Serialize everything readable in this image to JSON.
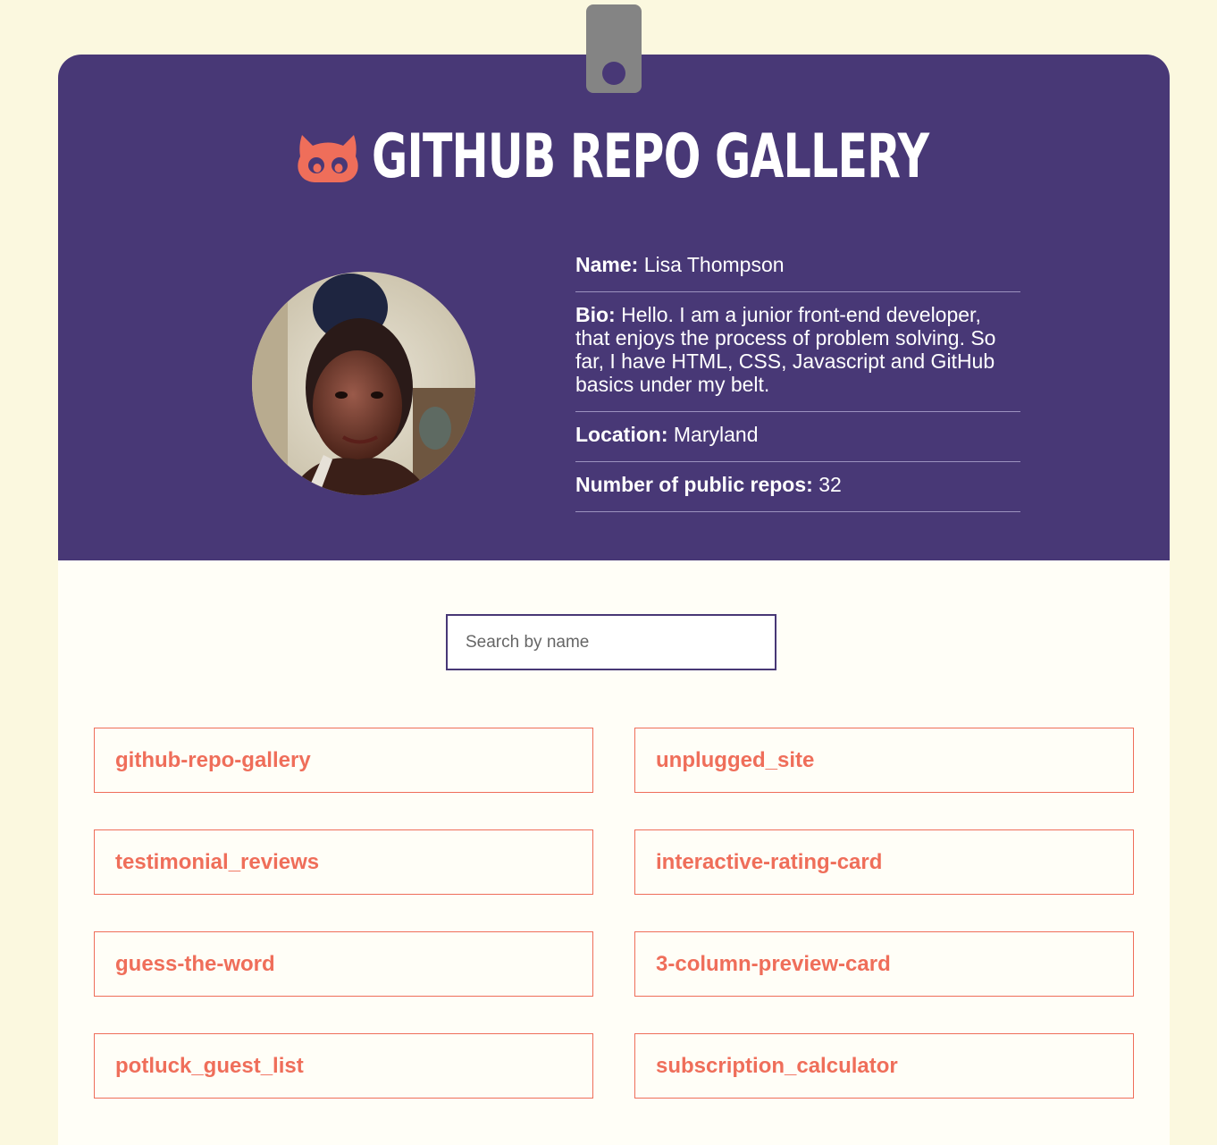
{
  "header": {
    "title": "GITHUB REPO GALLERY"
  },
  "profile": {
    "name_label": "Name:",
    "name": "Lisa Thompson",
    "bio_label": "Bio:",
    "bio": "Hello. I am a junior front-end developer, that enjoys the process of problem solving. So far, I have HTML, CSS, Javascript and GitHub basics under my belt.",
    "location_label": "Location:",
    "location": "Maryland",
    "repos_label": "Number of public repos:",
    "repos_count": "32"
  },
  "search": {
    "placeholder": "Search by name"
  },
  "repos": [
    {
      "name": "github-repo-gallery"
    },
    {
      "name": "unplugged_site"
    },
    {
      "name": "testimonial_reviews"
    },
    {
      "name": "interactive-rating-card"
    },
    {
      "name": "guess-the-word"
    },
    {
      "name": "3-column-preview-card"
    },
    {
      "name": "potluck_guest_list"
    },
    {
      "name": "subscription_calculator"
    }
  ],
  "colors": {
    "background": "#fbf8df",
    "header": "#483876",
    "accent": "#ef6e5a",
    "clip": "#848484"
  },
  "icons": {
    "logo": "octocat-icon"
  }
}
